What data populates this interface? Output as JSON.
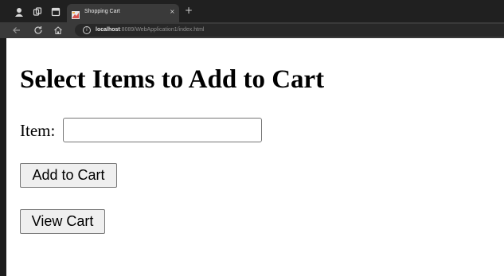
{
  "browser": {
    "tab_title": "Shopping Cart",
    "tab_close": "×",
    "new_tab": "+",
    "url_host": "localhost",
    "url_rest": ":8089/WebApplication1/index.html",
    "icons": [
      "profile-icon",
      "workspaces-icon",
      "tab-actions-icon",
      "back-icon",
      "refresh-icon",
      "home-icon",
      "info-icon"
    ]
  },
  "page": {
    "title": "Select Items to Add to Cart",
    "item_label": "Item:",
    "item_value": "",
    "add_button": "Add to Cart",
    "view_button": "View Cart"
  },
  "colors": {
    "tabstrip": "#202020",
    "toolbar": "#3a3a3a",
    "omnibox": "#282828",
    "button_face": "#efefef",
    "button_border": "#767676"
  }
}
